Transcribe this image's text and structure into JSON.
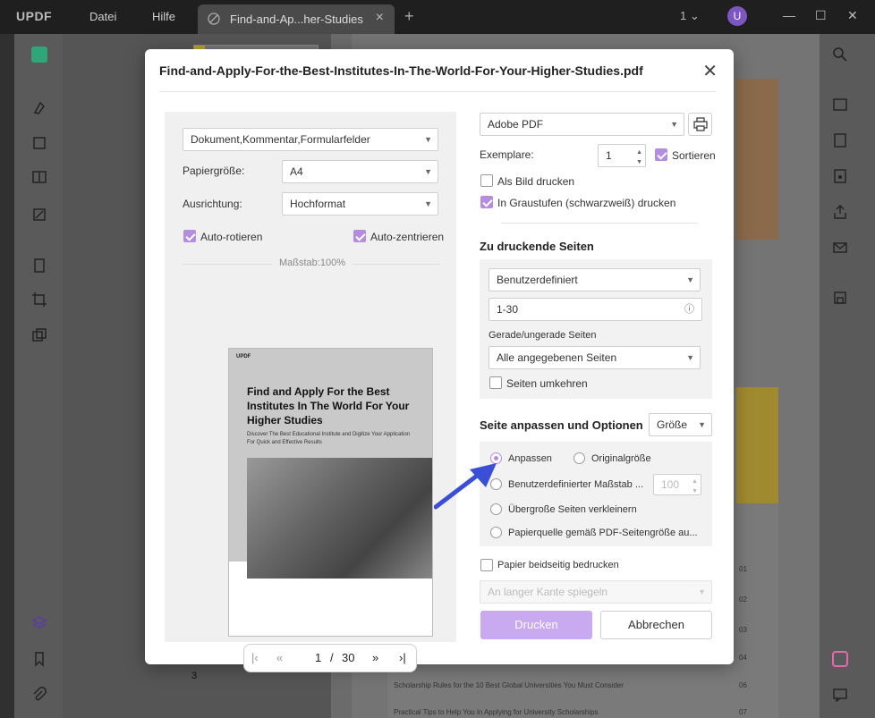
{
  "app": {
    "logo": "UPDF",
    "menu": [
      "Datei",
      "Hilfe"
    ],
    "tab_title": "Find-and-Ap...her-Studies",
    "page_indicator": "1",
    "avatar_letter": "U"
  },
  "dialog": {
    "title": "Find-and-Apply-For-the-Best-Institutes-In-The-World-For-Your-Higher-Studies.pdf",
    "content_select": "Dokument,Kommentar,Formularfelder",
    "paper_size_label": "Papiergröße:",
    "paper_size_value": "A4",
    "orientation_label": "Ausrichtung:",
    "orientation_value": "Hochformat",
    "auto_rotate_label": "Auto-rotieren",
    "auto_center_label": "Auto-zentrieren",
    "scale_text": "Maßstab:100%",
    "preview": {
      "logo": "UPDF",
      "title": "Find and Apply For the Best Institutes In The World For Your Higher Studies",
      "subtitle": "Discover The Best Educational Institute and Digitize Your Application For Quick and Effective Results"
    },
    "pager": {
      "current": "1",
      "separator": "/",
      "total": "30"
    },
    "printer_value": "Adobe PDF",
    "copies_label": "Exemplare:",
    "copies_value": "1",
    "collate_label": "Sortieren",
    "print_as_image_label": "Als Bild drucken",
    "grayscale_label": "In Graustufen (schwarzweiß) drucken",
    "pages_section_title": "Zu druckende Seiten",
    "pages_mode_value": "Benutzerdefiniert",
    "pages_range_value": "1-30",
    "even_odd_label": "Gerade/ungerade Seiten",
    "even_odd_value": "Alle angegebenen Seiten",
    "reverse_label": "Seiten umkehren",
    "fit_section_title": "Seite anpassen und Optionen",
    "size_select_value": "Größe",
    "opt_fit_label": "Anpassen",
    "opt_original_label": "Originalgröße",
    "opt_custom_scale_label": "Benutzerdefinierter Maßstab ...",
    "custom_scale_value": "100",
    "opt_shrink_label": "Übergroße Seiten verkleinern",
    "opt_paper_source_label": "Papierquelle gemäß PDF-Seitengröße au...",
    "duplex_label": "Papier beidseitig bedrucken",
    "duplex_mode_value": "An langer Kante spiegeln",
    "print_button": "Drucken",
    "cancel_button": "Abbrechen"
  },
  "background": {
    "thumb_page_number": "3",
    "toc": [
      {
        "text": "Scholarship Rules for the 10 Best Global Universities You Must Consider",
        "page": "06"
      },
      {
        "text": "Practical Tips to Help You in Applying for University Scholarships",
        "page": "07"
      }
    ],
    "toc_numbers": [
      "01",
      "02",
      "03",
      "04",
      "05"
    ]
  },
  "colors": {
    "accent": "#b48ce0",
    "primary_button": "#c9a9ef",
    "annotation_arrow": "#3a4fd6"
  }
}
